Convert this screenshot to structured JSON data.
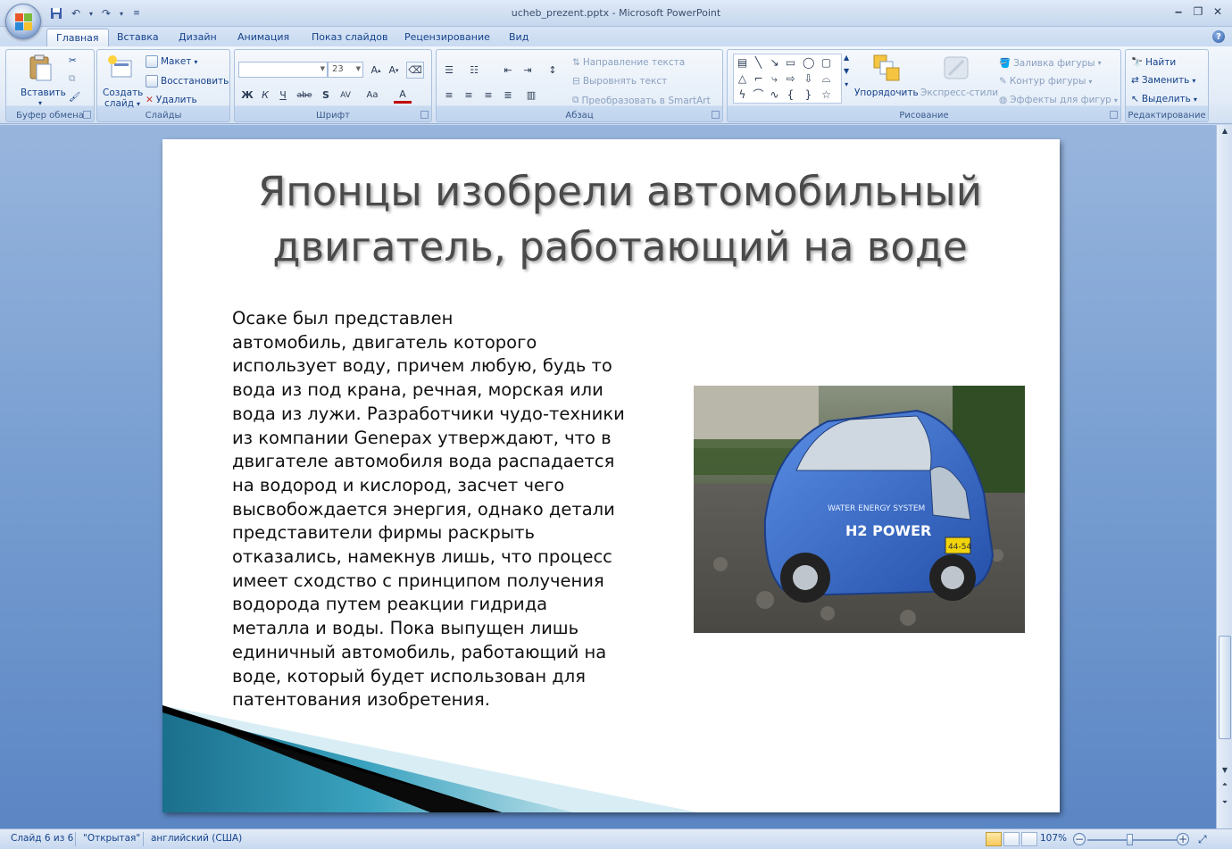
{
  "window": {
    "title": "ucheb_prezent.pptx - Microsoft PowerPoint",
    "controls": {
      "minimize": "‒",
      "restore": "❐",
      "close": "✕"
    }
  },
  "tabs": [
    {
      "label": "Главная",
      "active": true
    },
    {
      "label": "Вставка"
    },
    {
      "label": "Дизайн"
    },
    {
      "label": "Анимация"
    },
    {
      "label": "Показ слайдов"
    },
    {
      "label": "Рецензирование"
    },
    {
      "label": "Вид"
    }
  ],
  "ribbon": {
    "clipboard": {
      "label": "Буфер обмена",
      "paste": "Вставить"
    },
    "slides": {
      "label": "Слайды",
      "new_slide_line1": "Создать",
      "new_slide_line2": "слайд",
      "layout": "Макет",
      "reset": "Восстановить",
      "delete": "Удалить"
    },
    "font": {
      "label": "Шрифт",
      "size": "23"
    },
    "paragraph": {
      "label": "Абзац",
      "text_direction": "Направление текста",
      "align_text": "Выровнять текст",
      "smartart": "Преобразовать в SmartArt"
    },
    "drawing": {
      "label": "Рисование",
      "arrange": "Упорядочить",
      "quick_styles": "Экспресс-стили",
      "shape_fill": "Заливка фигуры",
      "shape_outline": "Контур фигуры",
      "shape_effects": "Эффекты для фигур"
    },
    "editing": {
      "label": "Редактирование",
      "find": "Найти",
      "replace": "Заменить",
      "select": "Выделить"
    }
  },
  "slide": {
    "title_line1": "Японцы изобрели автомобильный",
    "title_line2": "двигатель, работающий на воде",
    "body_lines": [
      "Осаке был представлен",
      "автомобиль, двигатель которого",
      "использует воду, причем любую, будь то",
      "вода из под крана, речная, морская или",
      "вода из лужи. Разработчики чудо-техники",
      "из компании Genepax утверждают, что в",
      "двигателе автомобиля вода распадается",
      "на водород и кислород, засчет чего",
      "высвобождается энергия, однако детали",
      "представители фирмы раскрыть",
      "отказались, намекнув лишь, что процесс",
      "имеет сходство с принципом получения",
      "водорода путем реакции гидрида",
      "металла и воды. Пока выпущен лишь",
      "единичный автомобиль, работающий на",
      "воде, который будет использован для",
      "патентования изобретения."
    ],
    "car_sign": "WATER ENERGY SYSTEM",
    "car_brand": "H2 POWER",
    "car_plate": "44-54"
  },
  "status": {
    "slide_info": "Слайд 6 из 6",
    "theme": "\"Открытая\"",
    "language": "английский (США)",
    "zoom": "107%",
    "zoom_level_percent": 107
  },
  "colors": {
    "ribbon_text": "#15428b",
    "workspace": "#7aa0d2",
    "slide_accent": "#2a8aa8",
    "car_body": "#3a6fd0"
  }
}
